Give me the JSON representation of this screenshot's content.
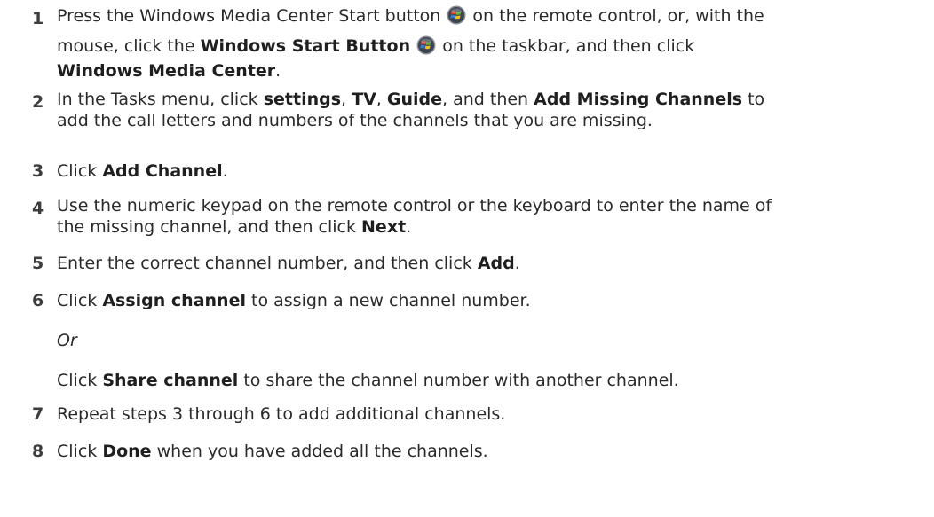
{
  "steps": [
    {
      "number": "1",
      "lines": [
        {
          "t1": "Press the Windows Media Center Start button ",
          "t2": " on the remote control, or, with the"
        },
        {
          "t1": "mouse, click the ",
          "b1": "Windows Start Button",
          "t2": " on the taskbar, and then click"
        },
        {
          "b1": "Windows Media Center",
          "t2": "."
        }
      ]
    },
    {
      "number": "2",
      "t1": "In the Tasks menu, click ",
      "b1": "settings",
      "sep1": ", ",
      "b2": "TV",
      "sep2": ", ",
      "b3": "Guide",
      "t2": ", and then ",
      "b4": "Add Missing Channels",
      "t3": " to",
      "line2": "add the call letters and numbers of the channels that you are missing."
    },
    {
      "number": "3",
      "t1": "Click ",
      "b1": "Add Channel",
      "t2": "."
    },
    {
      "number": "4",
      "line1": "Use the numeric keypad on the remote control or the keyboard to enter the name of",
      "t1": "the missing channel, and then click ",
      "b1": "Next",
      "t2": "."
    },
    {
      "number": "5",
      "t1": "Enter the correct channel number, and then click ",
      "b1": "Add",
      "t2": "."
    },
    {
      "number": "6",
      "t1": "Click ",
      "b1": "Assign channel",
      "t2": " to assign a new channel number.",
      "or": "Or",
      "t3": "Click ",
      "b2": "Share channel",
      "t4": " to share the channel number with another channel."
    },
    {
      "number": "7",
      "text": "Repeat steps 3 through 6 to add additional channels."
    },
    {
      "number": "8",
      "t1": "Click ",
      "b1": "Done",
      "t2": " when you have added all the channels."
    }
  ],
  "icons": {
    "start_button": "windows-start-orb",
    "colors": [
      "#e8392b",
      "#5aa832",
      "#2f7fd8",
      "#f4c020"
    ]
  }
}
